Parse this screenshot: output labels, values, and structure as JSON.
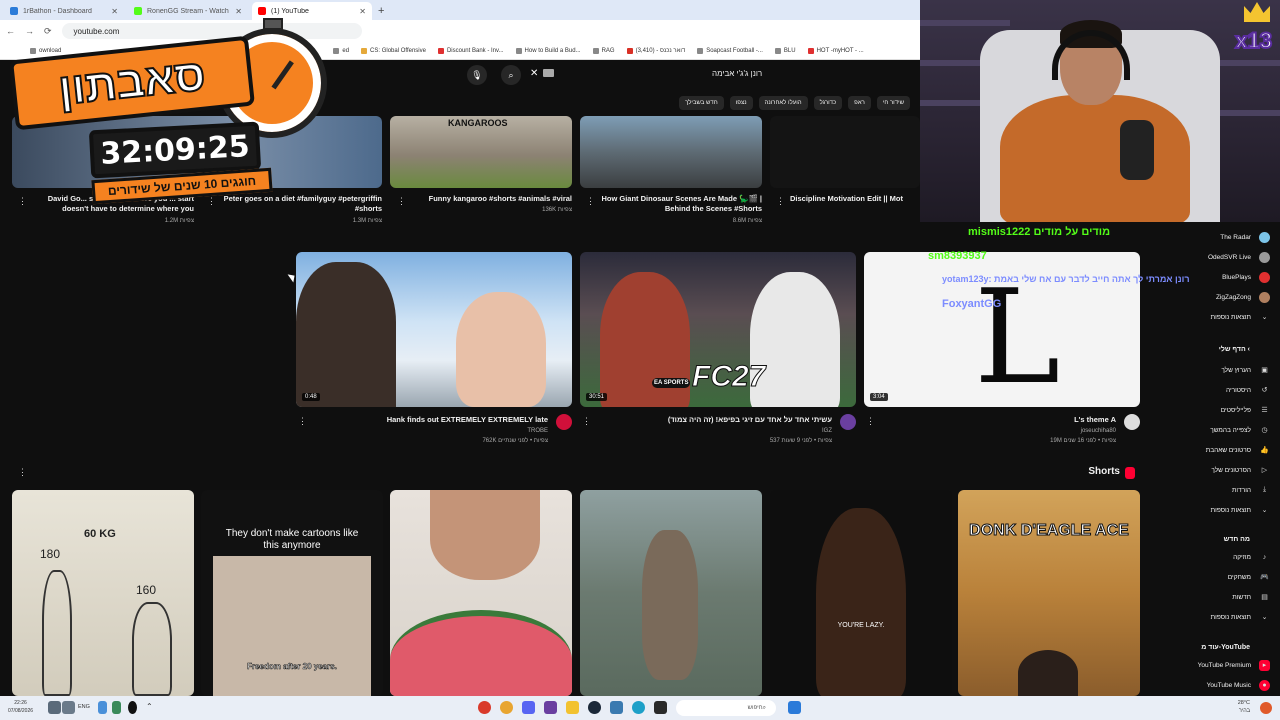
{
  "browser": {
    "tabs": [
      {
        "label": "1rBathon - Dashboard",
        "color": "#2b7bd8"
      },
      {
        "label": "RonenGG Stream - Watch Live",
        "color": "#53fc18"
      },
      {
        "label": "(1) YouTube",
        "color": "#ff0000"
      }
    ],
    "url": "youtube.com",
    "bookmarks": [
      "ownload",
      "ed",
      "CS: Global Offensive",
      "Discount Bank - Inv...",
      "How to Build a Bud...",
      "RAG",
      "(3,410) - דואר נכנס",
      "Soapcast Football -...",
      "BLU",
      "HOT -myHOT - ...",
      "..."
    ]
  },
  "youtube": {
    "search_text": "רונן ג'ג'י אבימה",
    "chips": [
      "שידור חי",
      "ראפ",
      "כדורגל",
      "הועלו לאחרונה",
      "נצפו",
      "חדש בשבילך"
    ],
    "top_row": [
      {
        "title": "Discipline Motivation Edit || Mot",
        "meta": ""
      },
      {
        "title": "How Giant Dinosaur Scenes Are Made 🦕🎬 | Behind the Scenes #Shorts",
        "meta": "8.6M צפיות"
      },
      {
        "title": "Funny kangaroo #shorts #animals #viral",
        "meta": "136K צפיות"
      },
      {
        "title": "Peter goes on a diet #familyguy #petergriffin #shorts",
        "meta": "1.3M צפיות"
      },
      {
        "title": "David Go... shows that where you ... start doesn't have to determine where you",
        "meta": "1.2M צפיות"
      }
    ],
    "kangaroos_label": "KANGAROOS",
    "middle_row": [
      {
        "title": "L's theme A",
        "channel": "joseuchiha80",
        "meta": "19M צפיות • לפני 16 שנים",
        "duration": "3:04"
      },
      {
        "title": "עשיתי אחד על אחד עם זיגי בפיפא! (זה היה צמוד)",
        "channel": "IGZ",
        "meta": "537 צפיות • לפני 9 שעות",
        "duration": "30:51"
      },
      {
        "title": "Hank finds out EXTREMELY EXTREMELY late",
        "channel": "TROBE",
        "meta": "762K צפיות • לפני שנתיים",
        "duration": "0:48"
      }
    ],
    "fc_label": "FC27",
    "ea_label": "EA SPORTS",
    "shorts_header": "Shorts",
    "shorts": [
      {
        "overlay": "DONK D'EAGLE ACE"
      },
      {
        "overlay": "YOU'RE LAZY."
      },
      {
        "overlay": ""
      },
      {
        "overlay": ""
      },
      {
        "overlay": "They don't make cartoons like this anymore",
        "bottom": "Freedom after 20 years."
      },
      {
        "overlay": "60 KG",
        "n1": "180",
        "n2": "160"
      }
    ]
  },
  "sidebar": {
    "subs": [
      {
        "label": "The Radar",
        "color": "#7cc4e8"
      },
      {
        "label": "OdedSVR Live",
        "color": "#999"
      },
      {
        "label": "BluePlays",
        "color": "#e03030"
      },
      {
        "label": "ZigZagZong",
        "color": "#b08060"
      }
    ],
    "more1": "תוצאות נוספות",
    "you_header": "הדף שלי",
    "you_items": [
      "הערוץ שלך",
      "היסטוריה",
      "פלייליסטים",
      "לצפייה בהמשך",
      "סרטונים שאהבת",
      "הסרטונים שלך",
      "הורדות",
      "תוצאות נוספות"
    ],
    "new_header": "מה חדש",
    "new_items": [
      "מוזיקה",
      "משחקים",
      "חדשות",
      "תוצאות נוספות"
    ],
    "more_header": "עוד מ-YouTube",
    "more_items": [
      "YouTube Premium",
      "YouTube Music"
    ]
  },
  "chat": {
    "lines": [
      {
        "text": "mismis1222 מודים על מודים",
        "color": "#53fc18"
      },
      {
        "text": "sm8393937",
        "color": "#53fc18"
      },
      {
        "text": "yotam123y: רונן אמרתי לך אתה חייב לדבר עם אח שלי באמת",
        "color": "#7c8cff"
      },
      {
        "text": "FoxyantGG",
        "color": "#7c8cff"
      }
    ]
  },
  "timer": {
    "title": "סאבתון",
    "clock": "32:09:25",
    "subtitle": "חוגגים 10 שנים של שידורים"
  },
  "webcam": {
    "badge": "x13"
  },
  "taskbar": {
    "time": "22:26",
    "date": "07/08/2026",
    "search": "חיפוש",
    "temp": "28°C",
    "weather": "בהיר",
    "lang": "ENG"
  }
}
